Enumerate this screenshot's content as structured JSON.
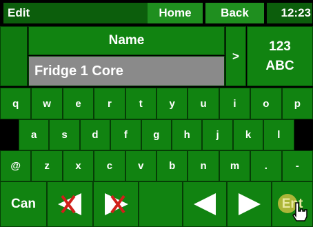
{
  "titlebar": {
    "edit": "Edit",
    "home": "Home",
    "back": "Back",
    "clock": "12:23"
  },
  "name_panel": {
    "label": "Name",
    "value": "Fridge 1 Core",
    "arrow": ">",
    "mode_line1": "123",
    "mode_line2": "ABC"
  },
  "keyboard": {
    "row1": [
      "q",
      "w",
      "e",
      "r",
      "t",
      "y",
      "u",
      "i",
      "o",
      "p"
    ],
    "row2": [
      "a",
      "s",
      "d",
      "f",
      "g",
      "h",
      "j",
      "k",
      "l"
    ],
    "row3": [
      "@",
      "z",
      "x",
      "c",
      "v",
      "b",
      "n",
      "m",
      ".",
      "-"
    ]
  },
  "bottom": {
    "cancel": "Can",
    "enter": "Ent"
  },
  "colors": {
    "key_green": "#118311",
    "field_gray": "#8a8a8a",
    "delete_x": "#d0201a"
  }
}
